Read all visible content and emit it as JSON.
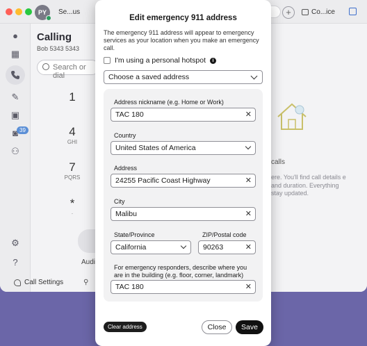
{
  "app": {
    "avatar_initials": "PY",
    "user_status": "Se...us",
    "contact_label": "Co...ice",
    "calling_title": "Calling",
    "calling_line": "Bob 5343 5343",
    "dial_search_placeholder": "Search or dial",
    "rail_badge": "39",
    "dialpad": [
      {
        "digit": "1",
        "letters": ""
      },
      {
        "digit": "4",
        "letters": "GHI"
      },
      {
        "digit": "7",
        "letters": "PQRS"
      },
      {
        "digit": "*",
        "letters": "·"
      }
    ],
    "audio_label": "Audi",
    "call_settings_label": "Call Settings",
    "pane_calls_label": "calls",
    "pane_body": "ere. You'll find call details e and duration. Everything stay updated."
  },
  "modal": {
    "title": "Edit emergency 911 address",
    "description": "The emergency 911 address will appear to emergency services as your location when you make an emergency call.",
    "hotspot_label": "I'm using a personal hotspot",
    "saved_address_placeholder": "Choose a saved address",
    "fields": {
      "nickname_label": "Address nickname (e.g. Home or Work)",
      "nickname_value": "TAC 180",
      "country_label": "Country",
      "country_value": "United States of America",
      "address_label": "Address",
      "address_value": "24255 Pacific Coast Highway",
      "city_label": "City",
      "city_value": "Malibu",
      "state_label": "State/Province",
      "state_value": "California",
      "zip_label": "ZIP/Postal code",
      "zip_value": "90263",
      "building_label": "For emergency responders, describe where you are in the building (e.g. floor, corner, landmark)",
      "building_value": "TAC 180"
    },
    "clear_address_label": "Clear address",
    "close_label": "Close",
    "save_label": "Save"
  }
}
